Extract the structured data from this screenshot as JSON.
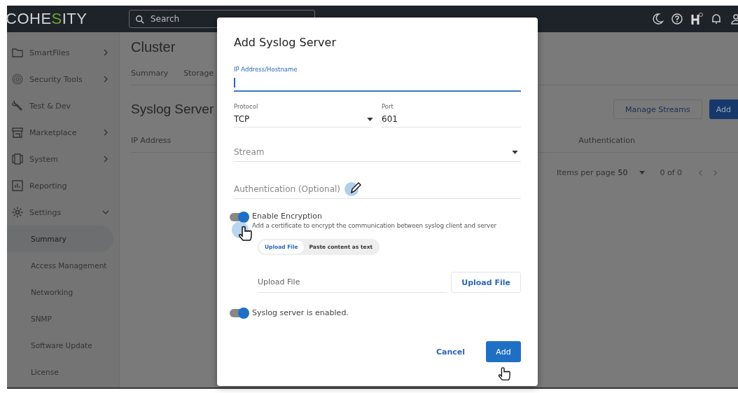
{
  "logo": {
    "before": "COHE",
    "accent": "S",
    "after": "ITY"
  },
  "search": {
    "placeholder": "Search"
  },
  "sidebar": {
    "items": [
      {
        "label": "SmartFiles",
        "expanded": false
      },
      {
        "label": "Security Tools",
        "expanded": false
      },
      {
        "label": "Test & Dev"
      },
      {
        "label": "Marketplace",
        "expanded": false
      },
      {
        "label": "System",
        "expanded": false
      },
      {
        "label": "Reporting"
      },
      {
        "label": "Settings",
        "expanded": true,
        "children": [
          {
            "label": "Summary",
            "selected": true
          },
          {
            "label": "Access Management",
            "selected": false
          },
          {
            "label": "Networking",
            "selected": false
          },
          {
            "label": "SNMP",
            "selected": false
          },
          {
            "label": "Software Update",
            "selected": false
          },
          {
            "label": "License",
            "selected": false
          }
        ]
      }
    ]
  },
  "page": {
    "title": "Cluster",
    "tabs": [
      "Summary",
      "Storage"
    ],
    "section_title": "Syslog Server",
    "buttons": {
      "manage": "Manage Streams",
      "add": "Add"
    },
    "columns": [
      "IP Address",
      "Authentication"
    ],
    "pagination": {
      "label": "Items per page",
      "page_size": "50",
      "range": "0 of 0"
    }
  },
  "dialog": {
    "title": "Add Syslog Server",
    "ip_field": {
      "label": "IP Address/Hostname",
      "focused": true
    },
    "protocol": {
      "label": "Protocol",
      "value": "TCP"
    },
    "port": {
      "label": "Port",
      "value": "601"
    },
    "stream": {
      "placeholder": "Stream"
    },
    "authentication": {
      "placeholder": "Authentication (Optional)"
    },
    "encryption": {
      "label": "Enable Encryption",
      "description": "Add a certificate to encrypt the communication between syslog client and server",
      "on": true
    },
    "segments": [
      {
        "label": "Upload File",
        "selected": true
      },
      {
        "label": "Paste content as text",
        "selected": false
      }
    ],
    "upload": {
      "placeholder": "Upload File",
      "button": "Upload File"
    },
    "enabled": {
      "label": "Syslog server is enabled.",
      "on": true
    },
    "buttons": {
      "cancel": "Cancel",
      "add": "Add"
    }
  }
}
